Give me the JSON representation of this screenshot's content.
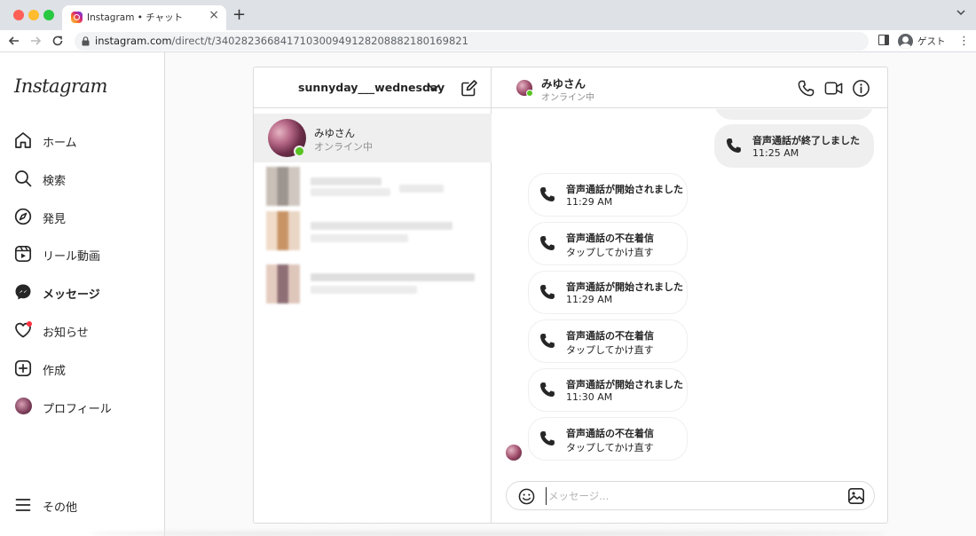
{
  "browser": {
    "tab_title": "Instagram • チャット",
    "url_host": "instagram.com",
    "url_path": "/direct/t/340282366841710300949128208882180169821",
    "profile_label": "ゲスト"
  },
  "sidebar": {
    "logo": "Instagram",
    "items": [
      {
        "label": "ホーム",
        "icon": "home-icon"
      },
      {
        "label": "検索",
        "icon": "search-icon"
      },
      {
        "label": "発見",
        "icon": "compass-icon"
      },
      {
        "label": "リール動画",
        "icon": "reels-icon"
      },
      {
        "label": "メッセージ",
        "icon": "messenger-icon"
      },
      {
        "label": "お知らせ",
        "icon": "heart-icon"
      },
      {
        "label": "作成",
        "icon": "plus-square-icon"
      },
      {
        "label": "プロフィール",
        "icon": "avatar"
      }
    ],
    "more_label": "その他"
  },
  "inbox": {
    "account_name": "sunnyday___wednesday",
    "threads": [
      {
        "name": "みゆさん",
        "status": "オンライン中"
      }
    ]
  },
  "chat": {
    "name": "みゆさん",
    "status": "オンライン中",
    "messages": [
      {
        "title": "音声通話が終了しました",
        "sub": "11:25 AM",
        "mine": true
      },
      {
        "title": "音声通話が開始されました",
        "sub": "11:29 AM",
        "mine": false
      },
      {
        "title": "音声通話の不在着信",
        "sub": "タップしてかけ直す",
        "mine": false
      },
      {
        "title": "音声通話が開始されました",
        "sub": "11:29 AM",
        "mine": false
      },
      {
        "title": "音声通話の不在着信",
        "sub": "タップしてかけ直す",
        "mine": false
      },
      {
        "title": "音声通話が開始されました",
        "sub": "11:30 AM",
        "mine": false
      },
      {
        "title": "音声通話の不在着信",
        "sub": "タップしてかけ直す",
        "mine": false
      }
    ],
    "input_placeholder": "メッセージ..."
  },
  "colors": {
    "online": "#58c322",
    "notification": "#ff3040",
    "border": "#dbdbdb",
    "selected_thread": "#efefef"
  }
}
